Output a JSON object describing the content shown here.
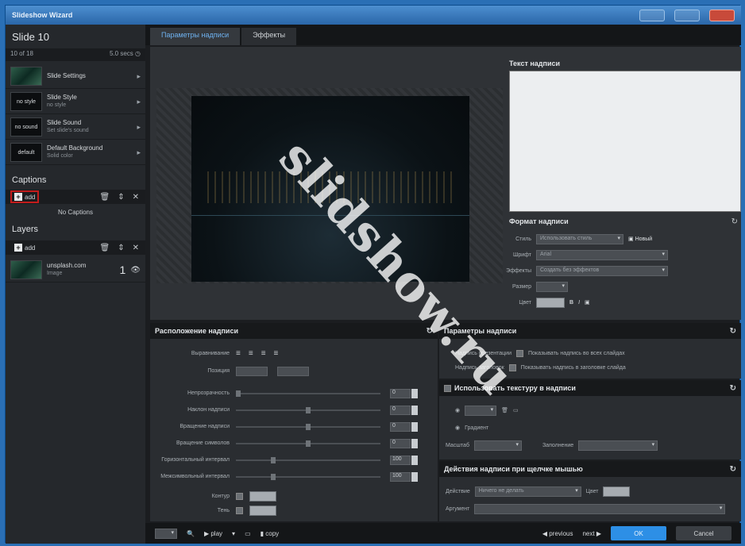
{
  "titlebar": {
    "app_name": "Slideshow Wizard"
  },
  "left": {
    "title": "Slide 10",
    "slide_info_left": "10 of 18",
    "slide_info_right": "5.0 secs",
    "items": [
      {
        "thumb": "",
        "label": "Slide Settings",
        "sub": ""
      },
      {
        "thumb": "no style",
        "label": "Slide Style",
        "sub": "no style"
      },
      {
        "thumb": "no sound",
        "label": "Slide Sound",
        "sub": "Set slide's sound"
      },
      {
        "thumb": "default",
        "label": "Default Background",
        "sub": "Solid color"
      }
    ],
    "captions_heading": "Captions",
    "add_label": "add",
    "no_captions": "No Captions",
    "layers_heading": "Layers",
    "layer_name": "unsplash.com",
    "layer_sub": "Image",
    "layer_num": "1"
  },
  "tabs": [
    {
      "label": "Параметры надписи",
      "active": true
    },
    {
      "label": "Эффекты",
      "active": false
    }
  ],
  "textpanel": {
    "title": "Текст надписи",
    "format_heading": "Формат надписи",
    "style_label": "Стиль",
    "style_value": "Использовать стиль",
    "style_btn": "Новый",
    "font_label": "Шрифт",
    "font_value": "Arial",
    "effects_label": "Эффекты",
    "effects_value": "Создать без эффектов",
    "size_label": "Размер",
    "color_label": "Цвет"
  },
  "loc": {
    "title": "Расположение надписи",
    "align_label": "Выравнивание",
    "pos_label": "Позиция",
    "rows": [
      {
        "label": "Непрозрачность",
        "value": "0"
      },
      {
        "label": "Наклон надписи",
        "value": "0"
      },
      {
        "label": "Вращение надписи",
        "value": "0"
      },
      {
        "label": "Вращение символов",
        "value": "0"
      },
      {
        "label": "Горизонтальный интервал",
        "value": "100"
      },
      {
        "label": "Межсимвольный интервал",
        "value": "100"
      }
    ],
    "outline_label": "Контур",
    "shadow_label": "Тень"
  },
  "params": {
    "title": "Параметры надписи",
    "opt1": "Надпись презентации",
    "opt1_desc": "Показывать надпись во всех слайдах",
    "opt2": "Надпись заголовок",
    "opt2_desc": "Показывать надпись в заголовке слайда"
  },
  "texture": {
    "title": "Использовать текстуру в надписи",
    "opt_a": "Градиент",
    "scale_label": "Масштаб",
    "fill_label": "Заполнение"
  },
  "mouse": {
    "title": "Действия надписи при щелчке мышью",
    "action_label": "Действие",
    "action_value": "Ничего не делать",
    "color_label": "Цвет",
    "arg_label": "Аргумент"
  },
  "bottombar": {
    "play": "play",
    "copy": "copy",
    "previous": "previous",
    "next": "next",
    "ok": "OK",
    "cancel": "Cancel"
  },
  "watermark": "slidshow.ru"
}
